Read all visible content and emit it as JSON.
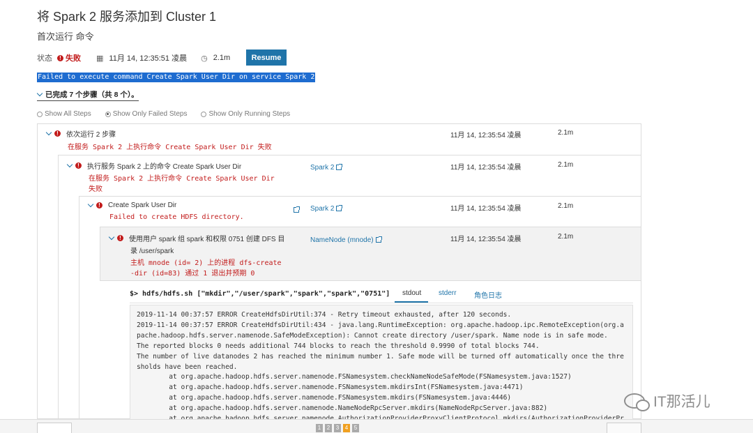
{
  "header": {
    "title": "将 Spark 2 服务添加到 Cluster 1",
    "subtitle": "首次运行 命令"
  },
  "status": {
    "label": "状态",
    "value": "失败",
    "time": "11月 14, 12:35:51 凌晨",
    "duration": "2.1m",
    "resume_label": "Resume"
  },
  "fail_banner": "Failed to execute command Create Spark User Dir on service Spark 2",
  "completed_steps": "已完成 7 个步骤（共 8 个）。",
  "filters": {
    "all": "Show All Steps",
    "failed": "Show Only Failed Steps",
    "running": "Show Only Running Steps"
  },
  "steps": [
    {
      "title": "依次运行 2 步骤",
      "error": "在服务 Spark 2 上执行命令 Create Spark User Dir 失败",
      "time": "11月 14, 12:35:54 凌晨",
      "duration": "2.1m"
    },
    {
      "title": "执行服务 Spark 2 上的命令 Create Spark User Dir",
      "error1": "在服务 Spark 2 上执行命令 Create Spark User Dir",
      "error2": "失败",
      "link": "Spark 2",
      "time": "11月 14, 12:35:54 凌晨",
      "duration": "2.1m"
    },
    {
      "title": "Create Spark User Dir",
      "error": "Failed to create HDFS directory.",
      "link": "Spark 2",
      "time": "11月 14, 12:35:54 凌晨",
      "duration": "2.1m"
    },
    {
      "title1": "使用用户 spark 组 spark 和权限 0751 创建 DFS 目",
      "title2": "录 /user/spark",
      "error1": "主机 mnode (id= 2) 上的进程 dfs-create",
      "error2": "-dir (id=83) 通过 1 退出并预期 0",
      "link": "NameNode (mnode)",
      "time": "11月 14, 12:35:54 凌晨",
      "duration": "2.1m"
    }
  ],
  "command_line": "$> hdfs/hdfs.sh [\"mkdir\",\"/user/spark\",\"spark\",\"spark\",\"0751\"]",
  "log_tabs": {
    "stdout": "stdout",
    "stderr": "stderr",
    "role_log": "角色日志"
  },
  "log_lines": [
    "2019-11-14 00:37:57 ERROR CreateHdfsDirUtil:374 - Retry timeout exhausted, after 120 seconds.",
    "2019-11-14 00:37:57 ERROR CreateHdfsDirUtil:434 - java.lang.RuntimeException: org.apache.hadoop.ipc.RemoteException(org.a",
    "pache.hadoop.hdfs.server.namenode.SafeModeException): Cannot create directory /user/spark. Name node is in safe mode.",
    "The reported blocks 0 needs additional 744 blocks to reach the threshold 0.9990 of total blocks 744.",
    "The number of live datanodes 2 has reached the minimum number 1. Safe mode will be turned off automatically once the thre",
    "sholds have been reached.",
    "        at org.apache.hadoop.hdfs.server.namenode.FSNamesystem.checkNameNodeSafeMode(FSNamesystem.java:1527)",
    "        at org.apache.hadoop.hdfs.server.namenode.FSNamesystem.mkdirsInt(FSNamesystem.java:4471)",
    "        at org.apache.hadoop.hdfs.server.namenode.FSNamesystem.mkdirs(FSNamesystem.java:4446)",
    "        at org.apache.hadoop.hdfs.server.namenode.NameNodeRpcServer.mkdirs(NameNodeRpcServer.java:882)",
    "        at org.apache.hadoop.hdfs.server.namenode.AuthorizationProviderProxyClientProtocol.mkdirs(AuthorizationProviderPr"
  ],
  "pager": [
    "1",
    "2",
    "3",
    "4",
    "5"
  ],
  "watermark": "IT那活儿",
  "colors": {
    "accent": "#1f74a9",
    "error": "#c21b1b",
    "pager_active": "#f0a020"
  }
}
